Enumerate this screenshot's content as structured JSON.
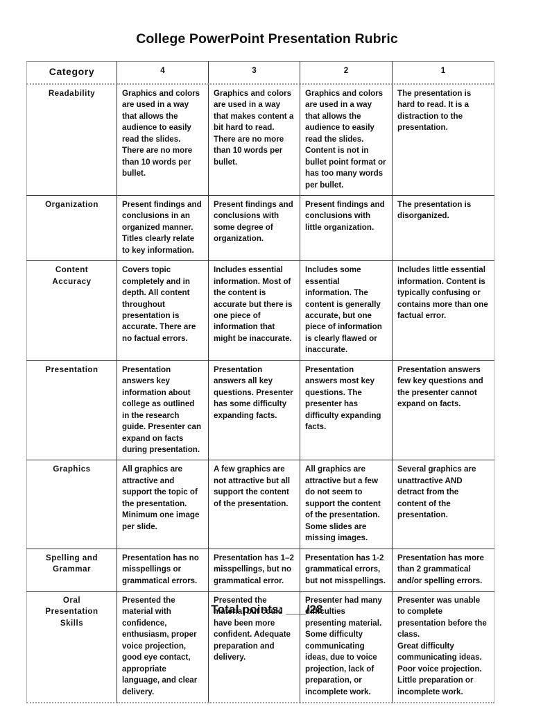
{
  "document": {
    "title": "College PowerPoint Presentation Rubric",
    "total_line": "Total points: ___/28"
  },
  "table": {
    "headers": [
      "Category",
      "4",
      "3",
      "2",
      "1"
    ],
    "rows": [
      {
        "category": "Readability",
        "level4": "Graphics and colors are used in a way that allows the audience to easily read the slides. There are no more than 10 words per bullet.",
        "level3": "Graphics and colors are used in a way that makes content a bit hard to read. There are no more than 10 words per bullet.",
        "level2": "Graphics and colors are used in a way that allows the audience to easily read the slides. Content is not in bullet point format or has too many words per bullet.",
        "level1": "The presentation is hard to read. It is a distraction to the presentation."
      },
      {
        "category": "Organization",
        "level4": "Present findings and conclusions in an organized manner. Titles clearly relate to key information.",
        "level3": "Present findings and conclusions with some degree of organization.",
        "level2": "Present findings and conclusions with little organization.",
        "level1": "The presentation is disorganized."
      },
      {
        "category": "Content\nAccuracy",
        "level4": "Covers topic completely and in depth.  All content throughout presentation is accurate.  There are no factual errors.",
        "level3": "Includes essential information.  Most of the content is accurate but there is one piece of information that might be inaccurate.",
        "level2": "Includes some essential information.  The content is generally accurate, but one piece of information is clearly flawed or inaccurate.",
        "level1": "Includes little essential information.  Content is typically confusing or contains more than one factual error."
      },
      {
        "category": "Presentation",
        "level4": "Presentation answers key information about college as outlined in the research guide. Presenter can expand on facts during presentation.",
        "level3": "Presentation answers all key questions. Presenter has some difficulty expanding facts.",
        "level2": "Presentation answers most key questions.  The presenter has difficulty expanding facts.",
        "level1": "Presentation answers few key questions and the presenter cannot expand on facts."
      },
      {
        "category": "Graphics",
        "level4": "All graphics are attractive and support the topic of the presentation. Minimum one image per slide.",
        "level3": "A few graphics are not attractive but all support the content of the presentation.",
        "level2": "All graphics are attractive but a few do not seem to support the content of the presentation.\nSome slides are missing images.",
        "level1": "Several graphics are unattractive AND detract from the content of the presentation."
      },
      {
        "category": "Spelling and\nGrammar",
        "level4": "Presentation has no misspellings or grammatical errors.",
        "level3": "Presentation has 1–2 misspellings, but no grammatical error.",
        "level2": "Presentation has 1-2 grammatical errors, but not misspellings.",
        "level1": "Presentation has more than 2 grammatical and/or spelling errors."
      },
      {
        "category": "Oral\nPresentation\nSkills",
        "level4": "Presented the material with confidence, enthusiasm, proper voice projection, good eye contact, appropriate language, and clear delivery.",
        "level3": "Presented the material but could have been more confident. Adequate preparation and delivery.",
        "level2": "Presenter had many difficulties presenting material.\nSome difficulty communicating ideas, due to voice projection, lack of preparation, or incomplete work.",
        "level1": "Presenter was unable to complete presentation before the class.\nGreat difficulty communicating ideas.\nPoor voice projection.\nLittle preparation or incomplete work."
      }
    ]
  }
}
